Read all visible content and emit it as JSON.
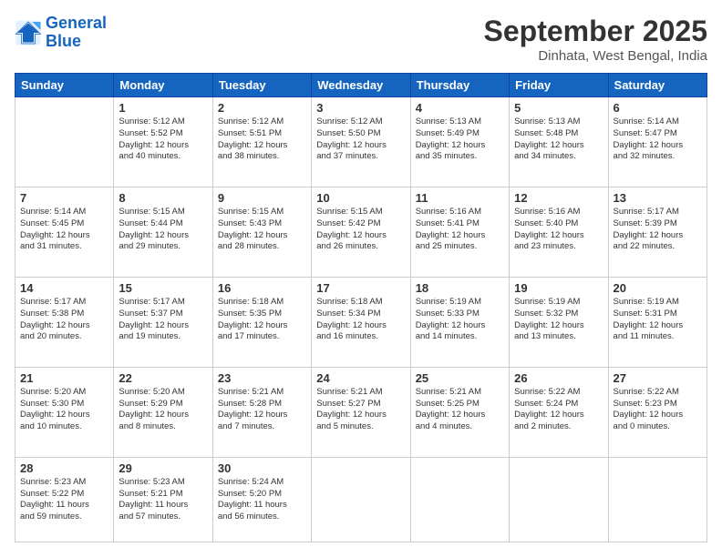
{
  "header": {
    "logo_line1": "General",
    "logo_line2": "Blue",
    "month": "September 2025",
    "location": "Dinhata, West Bengal, India"
  },
  "weekdays": [
    "Sunday",
    "Monday",
    "Tuesday",
    "Wednesday",
    "Thursday",
    "Friday",
    "Saturday"
  ],
  "weeks": [
    [
      {
        "day": "",
        "info": ""
      },
      {
        "day": "1",
        "info": "Sunrise: 5:12 AM\nSunset: 5:52 PM\nDaylight: 12 hours\nand 40 minutes."
      },
      {
        "day": "2",
        "info": "Sunrise: 5:12 AM\nSunset: 5:51 PM\nDaylight: 12 hours\nand 38 minutes."
      },
      {
        "day": "3",
        "info": "Sunrise: 5:12 AM\nSunset: 5:50 PM\nDaylight: 12 hours\nand 37 minutes."
      },
      {
        "day": "4",
        "info": "Sunrise: 5:13 AM\nSunset: 5:49 PM\nDaylight: 12 hours\nand 35 minutes."
      },
      {
        "day": "5",
        "info": "Sunrise: 5:13 AM\nSunset: 5:48 PM\nDaylight: 12 hours\nand 34 minutes."
      },
      {
        "day": "6",
        "info": "Sunrise: 5:14 AM\nSunset: 5:47 PM\nDaylight: 12 hours\nand 32 minutes."
      }
    ],
    [
      {
        "day": "7",
        "info": "Sunrise: 5:14 AM\nSunset: 5:45 PM\nDaylight: 12 hours\nand 31 minutes."
      },
      {
        "day": "8",
        "info": "Sunrise: 5:15 AM\nSunset: 5:44 PM\nDaylight: 12 hours\nand 29 minutes."
      },
      {
        "day": "9",
        "info": "Sunrise: 5:15 AM\nSunset: 5:43 PM\nDaylight: 12 hours\nand 28 minutes."
      },
      {
        "day": "10",
        "info": "Sunrise: 5:15 AM\nSunset: 5:42 PM\nDaylight: 12 hours\nand 26 minutes."
      },
      {
        "day": "11",
        "info": "Sunrise: 5:16 AM\nSunset: 5:41 PM\nDaylight: 12 hours\nand 25 minutes."
      },
      {
        "day": "12",
        "info": "Sunrise: 5:16 AM\nSunset: 5:40 PM\nDaylight: 12 hours\nand 23 minutes."
      },
      {
        "day": "13",
        "info": "Sunrise: 5:17 AM\nSunset: 5:39 PM\nDaylight: 12 hours\nand 22 minutes."
      }
    ],
    [
      {
        "day": "14",
        "info": "Sunrise: 5:17 AM\nSunset: 5:38 PM\nDaylight: 12 hours\nand 20 minutes."
      },
      {
        "day": "15",
        "info": "Sunrise: 5:17 AM\nSunset: 5:37 PM\nDaylight: 12 hours\nand 19 minutes."
      },
      {
        "day": "16",
        "info": "Sunrise: 5:18 AM\nSunset: 5:35 PM\nDaylight: 12 hours\nand 17 minutes."
      },
      {
        "day": "17",
        "info": "Sunrise: 5:18 AM\nSunset: 5:34 PM\nDaylight: 12 hours\nand 16 minutes."
      },
      {
        "day": "18",
        "info": "Sunrise: 5:19 AM\nSunset: 5:33 PM\nDaylight: 12 hours\nand 14 minutes."
      },
      {
        "day": "19",
        "info": "Sunrise: 5:19 AM\nSunset: 5:32 PM\nDaylight: 12 hours\nand 13 minutes."
      },
      {
        "day": "20",
        "info": "Sunrise: 5:19 AM\nSunset: 5:31 PM\nDaylight: 12 hours\nand 11 minutes."
      }
    ],
    [
      {
        "day": "21",
        "info": "Sunrise: 5:20 AM\nSunset: 5:30 PM\nDaylight: 12 hours\nand 10 minutes."
      },
      {
        "day": "22",
        "info": "Sunrise: 5:20 AM\nSunset: 5:29 PM\nDaylight: 12 hours\nand 8 minutes."
      },
      {
        "day": "23",
        "info": "Sunrise: 5:21 AM\nSunset: 5:28 PM\nDaylight: 12 hours\nand 7 minutes."
      },
      {
        "day": "24",
        "info": "Sunrise: 5:21 AM\nSunset: 5:27 PM\nDaylight: 12 hours\nand 5 minutes."
      },
      {
        "day": "25",
        "info": "Sunrise: 5:21 AM\nSunset: 5:25 PM\nDaylight: 12 hours\nand 4 minutes."
      },
      {
        "day": "26",
        "info": "Sunrise: 5:22 AM\nSunset: 5:24 PM\nDaylight: 12 hours\nand 2 minutes."
      },
      {
        "day": "27",
        "info": "Sunrise: 5:22 AM\nSunset: 5:23 PM\nDaylight: 12 hours\nand 0 minutes."
      }
    ],
    [
      {
        "day": "28",
        "info": "Sunrise: 5:23 AM\nSunset: 5:22 PM\nDaylight: 11 hours\nand 59 minutes."
      },
      {
        "day": "29",
        "info": "Sunrise: 5:23 AM\nSunset: 5:21 PM\nDaylight: 11 hours\nand 57 minutes."
      },
      {
        "day": "30",
        "info": "Sunrise: 5:24 AM\nSunset: 5:20 PM\nDaylight: 11 hours\nand 56 minutes."
      },
      {
        "day": "",
        "info": ""
      },
      {
        "day": "",
        "info": ""
      },
      {
        "day": "",
        "info": ""
      },
      {
        "day": "",
        "info": ""
      }
    ]
  ]
}
